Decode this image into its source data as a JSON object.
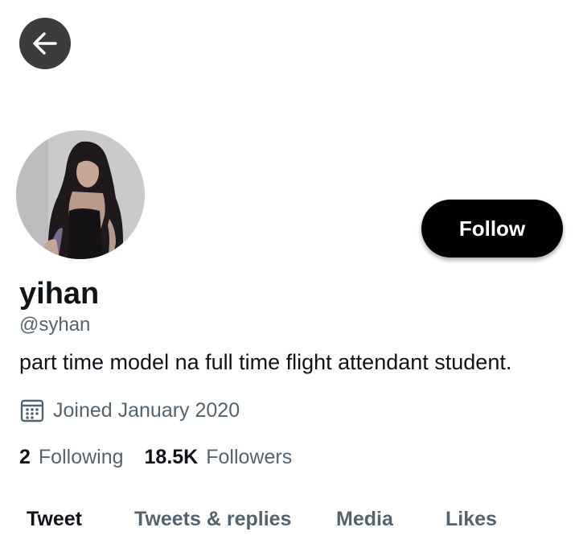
{
  "header": {
    "back_icon": "arrow-left-icon",
    "back_bg": "#3c3c3c"
  },
  "profile": {
    "avatar": "profile-photo",
    "display_name": "yihan",
    "handle": "@syhan",
    "bio": "part time model na full time flight attendant student.",
    "joined_icon": "calendar-icon",
    "joined_text": "Joined January 2020"
  },
  "follow_button": {
    "label": "Follow",
    "bg": "#000000",
    "fg": "#ffffff"
  },
  "stats": {
    "following_count": "2",
    "following_label": "Following",
    "followers_count": "18.5K",
    "followers_label": "Followers"
  },
  "tabs": [
    {
      "label": "Tweet",
      "active": true
    },
    {
      "label": "Tweets & replies",
      "active": false
    },
    {
      "label": "Media",
      "active": false
    },
    {
      "label": "Likes",
      "active": false
    }
  ],
  "colors": {
    "text_primary": "#0f1419",
    "text_secondary": "#536471"
  }
}
